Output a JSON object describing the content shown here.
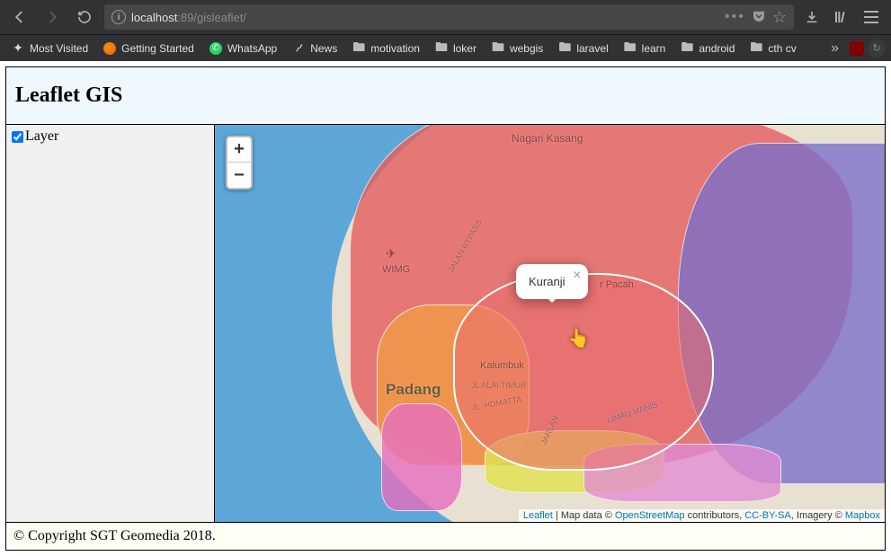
{
  "browser": {
    "url": {
      "host": "localhost",
      "port": ":89",
      "path": "/gisleaflet/"
    },
    "bookmarks": [
      {
        "icon": "star",
        "label": "Most Visited"
      },
      {
        "icon": "firefox",
        "label": "Getting Started"
      },
      {
        "icon": "whatsapp",
        "label": "WhatsApp"
      },
      {
        "icon": "rss",
        "label": "News"
      },
      {
        "icon": "folder",
        "label": "motivation"
      },
      {
        "icon": "folder",
        "label": "loker"
      },
      {
        "icon": "folder",
        "label": "webgis"
      },
      {
        "icon": "folder",
        "label": "laravel"
      },
      {
        "icon": "folder",
        "label": "learn"
      },
      {
        "icon": "folder",
        "label": "android"
      },
      {
        "icon": "folder",
        "label": "cth cv"
      }
    ]
  },
  "page": {
    "title": "Leaflet GIS",
    "sidebar": {
      "layer_label": "Layer",
      "layer_checked": true
    },
    "map": {
      "zoom_in": "+",
      "zoom_out": "−",
      "popup_text": "Kuranji",
      "city_label": "Padang",
      "labels": {
        "kasang": "Nagari Kasang",
        "wimg": "WIMG",
        "kalumbuk": "Kalumbuk",
        "pacah": "r Pacah"
      },
      "roads": {
        "bypass": "JALAN BYPASS",
        "alai": "JL ALAI TIMUR",
        "hamatta": "JL. HDMATTA",
        "jarlan": "JARLAN",
        "manis": "LIMAU MANIS"
      },
      "attribution": {
        "leaflet": "Leaflet",
        "sep1": " | Map data © ",
        "osm": "OpenStreetMap",
        "sep2": " contributors, ",
        "cc": "CC-BY-SA",
        "sep3": ", Imagery © ",
        "mapbox": "Mapbox"
      }
    },
    "footer": "© Copyright SGT Geomedia 2018."
  }
}
